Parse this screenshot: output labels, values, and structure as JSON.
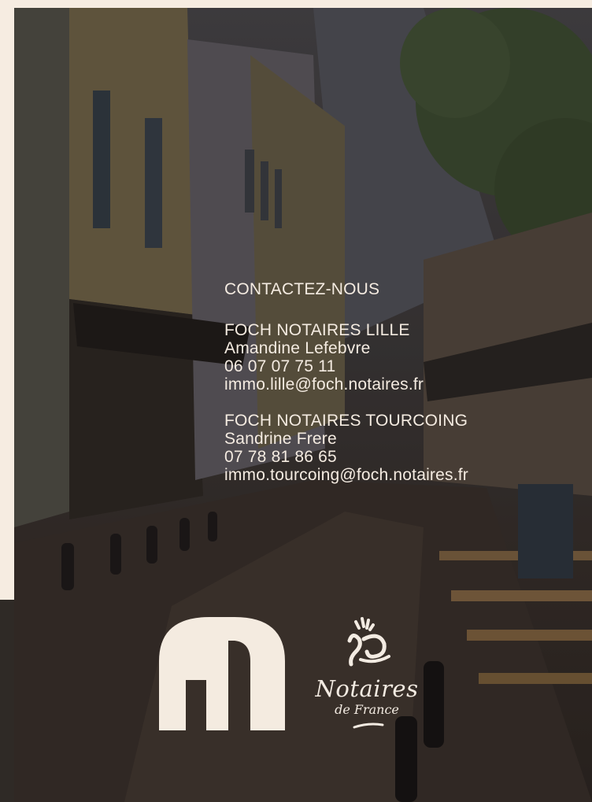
{
  "contact": {
    "heading": "CONTACTEZ-NOUS",
    "offices": [
      {
        "name": "FOCH NOTAIRES LILLE",
        "person": "Amandine Lefebvre",
        "phone": "06 07 07 75 11",
        "email": "immo.lille@foch.notaires.fr"
      },
      {
        "name": "FOCH NOTAIRES TOURCOING",
        "person": "Sandrine Frere",
        "phone": "07 78 81 86 65",
        "email": "immo.tourcoing@foch.notaires.fr"
      }
    ]
  },
  "logos": {
    "notaires_wordmark": "Notaires",
    "notaires_sub": "de France"
  },
  "colors": {
    "cream": "#f6ece1",
    "text": "#f4ebe1",
    "dark": "#2f2a26"
  }
}
